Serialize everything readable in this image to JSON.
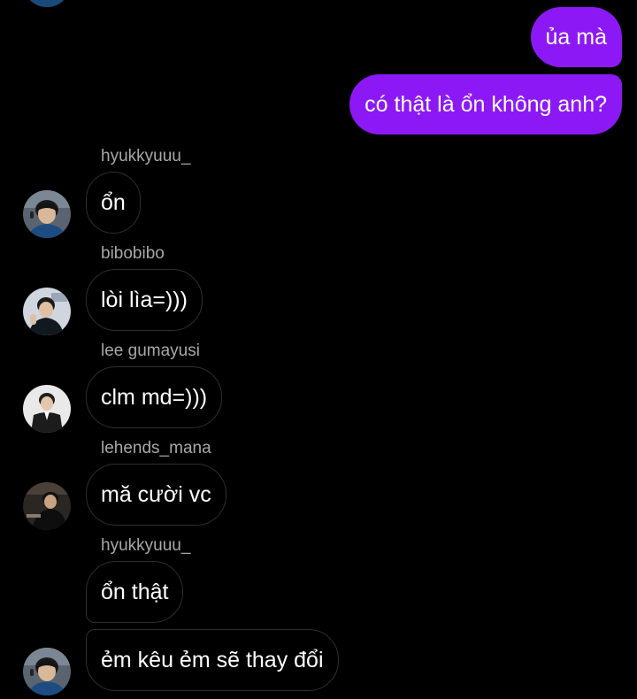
{
  "sent_messages": [
    {
      "text": "ủa mà"
    },
    {
      "text": "có thật là ổn không anh?"
    }
  ],
  "received_messages": [
    {
      "sender": "hyukkyuuu_",
      "text": "ổn"
    },
    {
      "sender": "bibobibo",
      "text": "lòi lìa=)))"
    },
    {
      "sender": "lee gumayusi",
      "text": "clm md=)))"
    },
    {
      "sender": "lehends_mana",
      "text": "mă cười vc"
    },
    {
      "sender": "hyukkyuuu_",
      "text": "ổn thật"
    },
    {
      "sender": "",
      "text": "ẻm kêu ẻm sẽ thay đổi"
    }
  ],
  "colors": {
    "background": "#000000",
    "sent_bubble": "#8c19f5",
    "received_border": "#2f2f2f",
    "sender_label": "#a8a8a8"
  }
}
